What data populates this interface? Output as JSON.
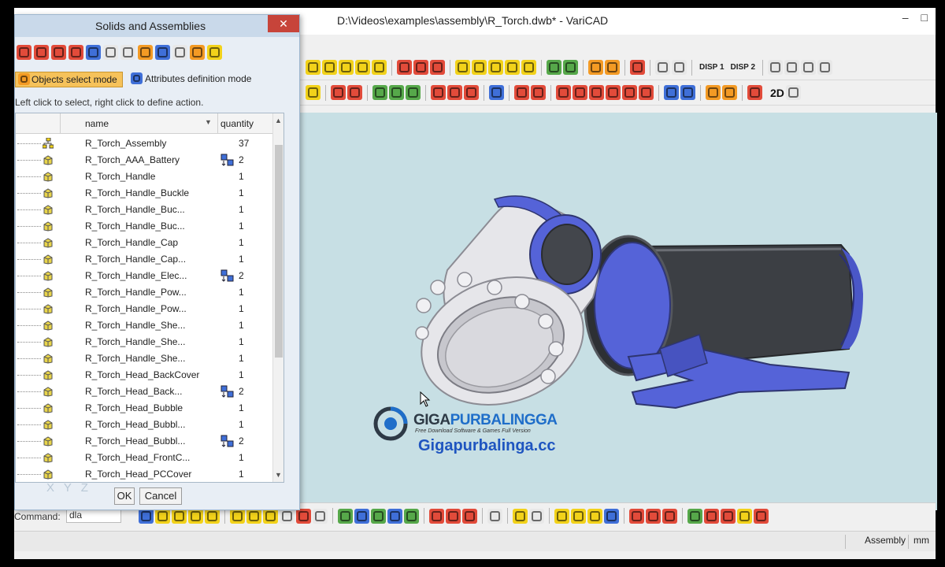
{
  "window": {
    "title": "D:\\Videos\\examples\\assembly\\R_Torch.dwb* - VariCAD",
    "minimize": "–",
    "maximize": "□"
  },
  "toolbar": {
    "disp1": "DISP 1",
    "disp2": "DISP 2",
    "mode_2d": "2D"
  },
  "dialog": {
    "title": "Solids and Assemblies",
    "close": "✕",
    "mode_objects": "Objects select mode",
    "mode_attributes": "Attributes definition mode",
    "hint": "Left click to select, right click to define action.",
    "columns": {
      "name": "name",
      "quantity": "quantity"
    },
    "rows": [
      {
        "name": "R_Torch_Assembly",
        "quantity": "37",
        "kind": "assembly"
      },
      {
        "name": "R_Torch_AAA_Battery",
        "quantity": "2",
        "kind": "multi"
      },
      {
        "name": "R_Torch_Handle",
        "quantity": "1",
        "kind": "part"
      },
      {
        "name": "R_Torch_Handle_Buckle",
        "quantity": "1",
        "kind": "part"
      },
      {
        "name": "R_Torch_Handle_Buc...",
        "quantity": "1",
        "kind": "part"
      },
      {
        "name": "R_Torch_Handle_Buc...",
        "quantity": "1",
        "kind": "part"
      },
      {
        "name": "R_Torch_Handle_Cap",
        "quantity": "1",
        "kind": "part"
      },
      {
        "name": "R_Torch_Handle_Cap...",
        "quantity": "1",
        "kind": "part"
      },
      {
        "name": "R_Torch_Handle_Elec...",
        "quantity": "2",
        "kind": "multi"
      },
      {
        "name": "R_Torch_Handle_Pow...",
        "quantity": "1",
        "kind": "part"
      },
      {
        "name": "R_Torch_Handle_Pow...",
        "quantity": "1",
        "kind": "part"
      },
      {
        "name": "R_Torch_Handle_She...",
        "quantity": "1",
        "kind": "part"
      },
      {
        "name": "R_Torch_Handle_She...",
        "quantity": "1",
        "kind": "part"
      },
      {
        "name": "R_Torch_Handle_She...",
        "quantity": "1",
        "kind": "part"
      },
      {
        "name": "R_Torch_Head_BackCover",
        "quantity": "1",
        "kind": "part"
      },
      {
        "name": "R_Torch_Head_Back...",
        "quantity": "2",
        "kind": "multi"
      },
      {
        "name": "R_Torch_Head_Bubble",
        "quantity": "1",
        "kind": "part"
      },
      {
        "name": "R_Torch_Head_Bubbl...",
        "quantity": "1",
        "kind": "part"
      },
      {
        "name": "R_Torch_Head_Bubbl...",
        "quantity": "2",
        "kind": "multi"
      },
      {
        "name": "R_Torch_Head_FrontC...",
        "quantity": "1",
        "kind": "part"
      },
      {
        "name": "R_Torch_Head_PCCover",
        "quantity": "1",
        "kind": "part"
      }
    ],
    "ok": "OK",
    "cancel": "Cancel",
    "axes_label": "X Y Z"
  },
  "command": {
    "label": "Command:",
    "value": "dla"
  },
  "status": {
    "mode": "Assembly",
    "units": "mm"
  },
  "watermark": {
    "brand_a": "GIGA",
    "brand_b": "PURBALINGGA",
    "tagline": "Free Download Software & Games Full Version",
    "site": "Gigapurbalinga.cc"
  },
  "colors": {
    "viewport_bg": "#c7dfe4",
    "assembly_blue": "#5563d8",
    "assembly_grey": "#3c3f44",
    "head_white": "#e6e6ea",
    "dialog_bg": "#e8eef5",
    "selected_mode": "#f6c25a"
  }
}
